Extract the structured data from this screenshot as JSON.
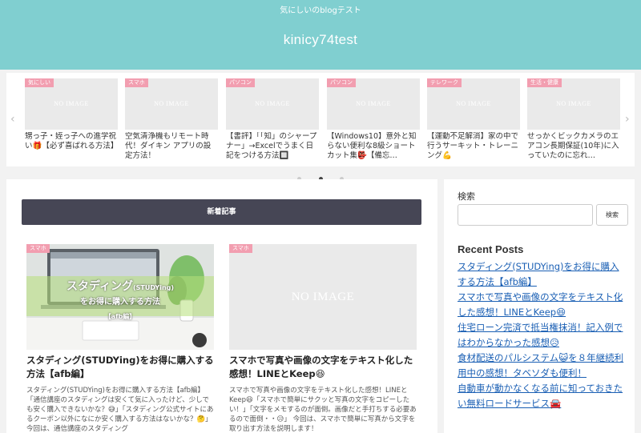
{
  "header": {
    "tagline": "気にしいのblogテスト",
    "site_title": "kinicy74test"
  },
  "carousel": {
    "prev_icon": "‹",
    "next_icon": "›",
    "no_image": "NO IMAGE",
    "items": [
      {
        "category": "気にしい",
        "title": "甥っ子・姪っ子への進学祝い🎁【必ず喜ばれる方法】"
      },
      {
        "category": "スマホ",
        "title": "空気清浄機もリモート時代！ダイキン アプリの設定方法！"
      },
      {
        "category": "パソコン",
        "title": "【書評】「「知」のシャープナー」→Excelでうまく日記をつける方法🔲"
      },
      {
        "category": "パソコン",
        "title": "【Windows10】意外と知らない便利な8級ショートカット集👺【備忘…"
      },
      {
        "category": "テレワーク",
        "title": "【運動不足解消】家の中で行うサーキット・トレーニング💪"
      },
      {
        "category": "生活・健康",
        "title": "せっかくビックカメラのエアコン長期保証(10年)に入っていたのに忘れ…"
      }
    ],
    "pagination_active": 2
  },
  "main": {
    "section_title": "新着記事",
    "posts": [
      {
        "category": "スマホ",
        "thumb_line1": "スタディング",
        "thumb_line1_small": "(STUDYing)",
        "thumb_line2": "をお得に購入する方法",
        "thumb_line3": "【afb編】",
        "title": "スタディング(STUDYing)をお得に購入する方法【afb編】",
        "excerpt": "スタディング(STUDYing)をお得に購入する方法【afb編】「通信講座のスタディングは安くて気に入ったけど、少しでも安く購入できないかな？😅」「スタディング公式サイトにあるクーポン以外になにか安く購入する方法はないかな？🤔」 今回は、通信講座のスタディング"
      },
      {
        "category": "スマホ",
        "no_image": "NO IMAGE",
        "title": "スマホで写真や画像の文字をテキスト化した感想！LINEとKeep😆",
        "excerpt": "スマホで写真や画像の文字をテキスト化した感想！LINEとKeep😆「スマホで簡単にサクッと写真の文字をコピーしたい！」「文字をメモするのが面倒。画像だと手打ちする必要あるので面倒・・😥」 今回は、スマホで簡単に写真から文字を取り出す方法を説明します！"
      }
    ]
  },
  "sidebar": {
    "search_label": "検索",
    "search_value": "",
    "search_button": "検索",
    "recent_title": "Recent Posts",
    "recent_posts": [
      "スタディング(STUDYing)をお得に購入する方法【afb編】",
      "スマホで写真や画像の文字をテキスト化した感想！LINEとKeep😆",
      "住宅ローン完済で抵当権抹消！記入例ではわからなかった感想😥",
      "食材配送のパルシステム😺を８年継続利用中の感想！タベソダも便利！",
      "自動車が動かなくなる前に知っておきたい無料ロードサービス🚘"
    ]
  },
  "colors": {
    "header_bg": "#80cfd0",
    "section_bar_bg": "#464655",
    "category_badge": "#f29eb0",
    "link": "#1a5fb4"
  }
}
